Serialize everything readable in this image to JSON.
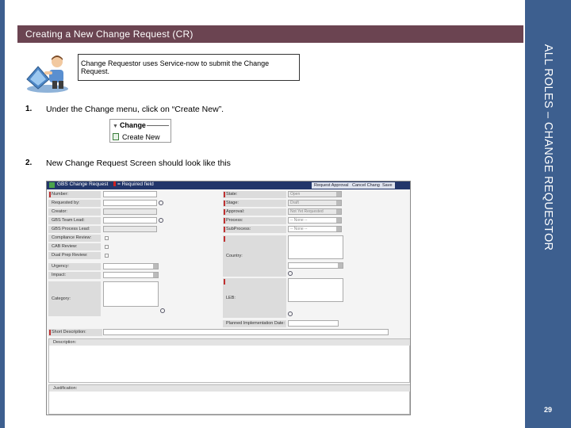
{
  "slide": {
    "title": "Creating a New Change Request (CR)",
    "side_banner": "ALL ROLES – CHANGE REQUESTOR",
    "page_number": "29",
    "callout_text": "Change Requestor uses Service-now to submit the Change Request.",
    "steps": [
      {
        "num": "1.",
        "text": "Under the Change menu, click on “Create New”."
      },
      {
        "num": "2.",
        "text": "New Change Request Screen should look like this"
      }
    ],
    "menu": {
      "header": "Change",
      "item": "Create New"
    }
  },
  "form": {
    "header_title": "GBS Change Request",
    "required_legend": "= Required field",
    "buttons": [
      "Request Approval",
      "Cancel Change",
      "Save"
    ],
    "left_fields": [
      "Number:",
      "Requested by:",
      "Creator:",
      "GBS Team Lead:",
      "GBS Process Lead:",
      "Compliance Review:",
      "CAB Review:",
      "Dual Prep Review:",
      "Urgency:",
      "Impact:",
      "Category:"
    ],
    "right_fields": [
      "State:",
      "Stage:",
      "Approval:",
      "Process:",
      "SubProcess:",
      "Country:",
      "LEB:",
      "Planned Implementation Date:"
    ],
    "right_values": [
      "Open",
      "Draft",
      "Not Yet Requested",
      "-- None --",
      "-- None --"
    ],
    "bottom_fields": [
      "Short Description:",
      "Description:",
      "Justification:"
    ]
  },
  "colors": {
    "title_bar": "#6b4451",
    "side_panel": "#3d5f8f",
    "form_header": "#22366a"
  }
}
